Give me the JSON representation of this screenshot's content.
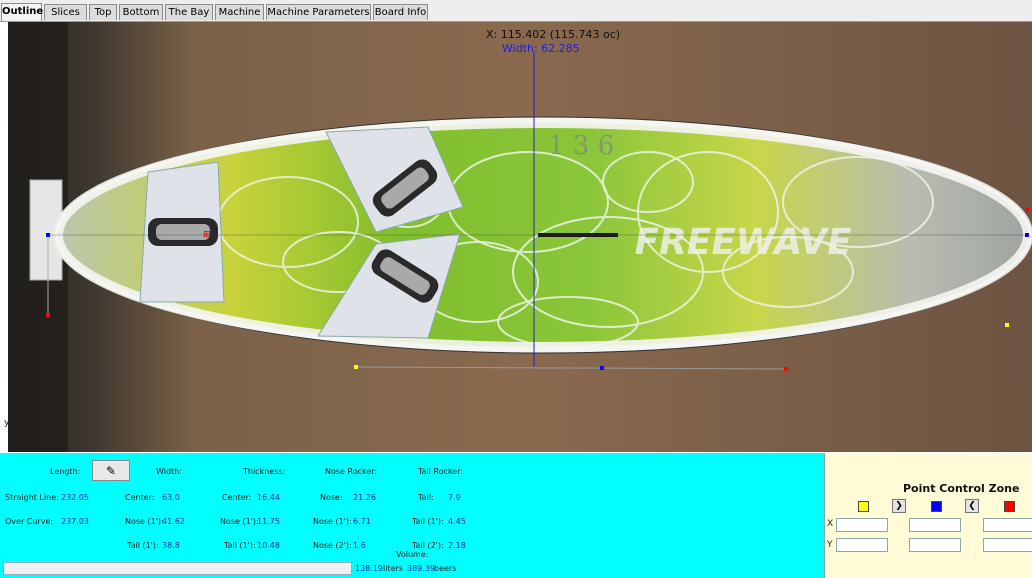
{
  "tabs": [
    "Outline",
    "Slices",
    "Top",
    "Bottom",
    "The Bay",
    "Machine",
    "Machine Parameters",
    "Board Info"
  ],
  "viewport": {
    "x_readout": "X: 115.402 (115.743 oc)",
    "width_readout": "Width: 62.285",
    "y_axis_label": "y",
    "board_number": "1 3 6",
    "board_brand": "FREEWAVE",
    "pad_logo": "⊞"
  },
  "measurements": {
    "length_label": "Length:",
    "width_label": "Width:",
    "thickness_label": "Thickness:",
    "nose_rocker_label": "Nose Rocker:",
    "tail_rocker_label": "Tail Rocker:",
    "straight_line_label": "Straight Line:",
    "straight_line": "232.05",
    "over_curve_label": "Over Curve:",
    "over_curve": "237.03",
    "width_center_label": "Center:",
    "width_center": "63.0",
    "width_nose_label": "Nose (1'):",
    "width_nose": "41.62",
    "width_tail_label": "Tail (1'):",
    "width_tail": "38.8",
    "thick_center_label": "Center:",
    "thick_center": "16.44",
    "thick_nose_label": "Nose (1'):",
    "thick_nose": "11.75",
    "thick_tail_label": "Tail (1'):",
    "thick_tail": "10.48",
    "nose_label": "Nose:",
    "nose": "21.26",
    "nose1_label": "Nose (1'):",
    "nose1": "6.71",
    "nose2_label": "Nose (2'):",
    "nose2": "1.6",
    "tail_label": "Tail:",
    "tail": "7.9",
    "tail1_label": "Tail (1'):",
    "tail1": "4.45",
    "tail2_label": "Tail (2'):",
    "tail2": "2.18",
    "volume_label": "Volume:",
    "volume_liters": "138.19",
    "liters_label": "liters",
    "volume_beers": "389.39",
    "beers_label": "beers"
  },
  "point_control": {
    "title": "Point Control Zone",
    "x_label": "X",
    "y_label": "Y",
    "swatch_colors": [
      "#ffff00",
      "#0000ff",
      "#ff0000"
    ],
    "next_glyph": "❯",
    "prev_glyph": "❮"
  },
  "icons": {
    "draw_button": "✎"
  },
  "colors": {
    "measure_bg": "#00ffff",
    "pcz_bg": "#fffbd6",
    "outline_blue": "#2222cc"
  }
}
